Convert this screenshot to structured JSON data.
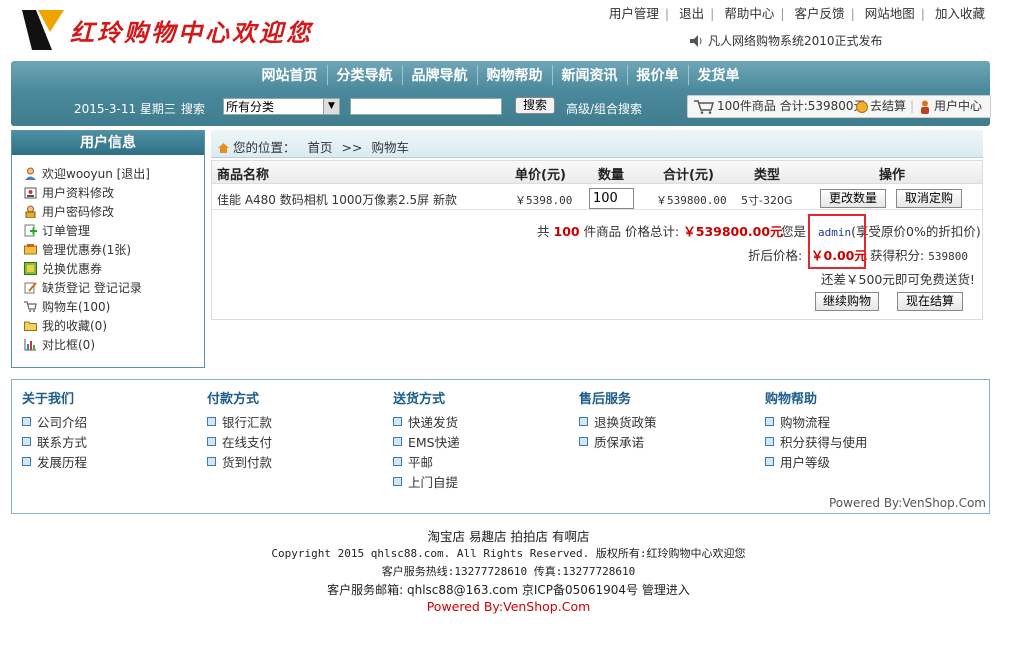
{
  "header": {
    "logo_text": "红玲购物中心欢迎您",
    "top_links": [
      "用户管理",
      "退出",
      "帮助中心",
      "客户反馈",
      "网站地图",
      "加入收藏"
    ],
    "notice": "凡人网络购物系统2010正式发布"
  },
  "nav": {
    "items": [
      "网站首页",
      "分类导航",
      "品牌导航",
      "购物帮助",
      "新闻资讯",
      "报价单",
      "发货单"
    ],
    "date": "2015-3-11 星期三",
    "search_label": "搜索",
    "category_select": "所有分类",
    "search_placeholder": "",
    "search_button": "搜索",
    "advanced_search": "高级/组合搜索",
    "cart_summary": "100件商品 合计:539800元",
    "checkout_link": "去结算",
    "user_center": "用户中心"
  },
  "sidebar": {
    "title": "用户信息",
    "items": [
      {
        "label": "欢迎wooyun [退出]",
        "icon": "user-icon"
      },
      {
        "label": "用户资料修改",
        "icon": "profile-icon"
      },
      {
        "label": "用户密码修改",
        "icon": "lock-icon"
      },
      {
        "label": "订单管理",
        "icon": "order-icon"
      },
      {
        "label": "管理优惠券(1张)",
        "icon": "coupon-icon"
      },
      {
        "label": "兑换优惠券",
        "icon": "exchange-icon"
      },
      {
        "label": "缺货登记 登记记录",
        "icon": "edit-icon"
      },
      {
        "label": "购物车(100)",
        "icon": "cart-icon"
      },
      {
        "label": "我的收藏(0)",
        "icon": "folder-icon"
      },
      {
        "label": "对比框(0)",
        "icon": "chart-icon"
      }
    ]
  },
  "breadcrumb": {
    "prefix": "您的位置：",
    "home": "首页",
    "separator": ">>",
    "current": "购物车"
  },
  "cart": {
    "columns": [
      "商品名称",
      "单价(元)",
      "数量",
      "合计(元)",
      "类型",
      "操作"
    ],
    "row": {
      "name": "佳能 A480 数码相机 1000万像素2.5屏 新款",
      "price": "￥5398.00",
      "quantity": "100",
      "subtotal": "￥539800.00",
      "type": "5寸-320G",
      "update_button": "更改数量",
      "cancel_button": "取消定购"
    },
    "summary_prefix": "共",
    "summary_count": "100",
    "summary_mid": "件商品 价格总计:",
    "summary_total": "￥539800.00元",
    "you_are": "您是",
    "member_name": "admin",
    "member_discount": "(享受原价0%的折扣价)",
    "discount_label": "折后价格:",
    "discount_price": "￥0.00元",
    "points_label": "获得积分:",
    "points_value": "539800",
    "shipping_note": "还差￥500元即可免费送货!",
    "continue_button": "继续购物",
    "checkout_button": "现在结算"
  },
  "footer_links": {
    "columns": [
      {
        "title": "关于我们",
        "items": [
          "公司介绍",
          "联系方式",
          "发展历程"
        ]
      },
      {
        "title": "付款方式",
        "items": [
          "银行汇款",
          "在线支付",
          "货到付款"
        ]
      },
      {
        "title": "送货方式",
        "items": [
          "快递发货",
          "EMS快递",
          "平邮",
          "上门自提"
        ]
      },
      {
        "title": "售后服务",
        "items": [
          "退换货政策",
          "质保承诺"
        ]
      },
      {
        "title": "购物帮助",
        "items": [
          "购物流程",
          "积分获得与使用",
          "用户等级"
        ]
      }
    ],
    "powered": "Powered By:VenShop.Com"
  },
  "bottom": {
    "shops": "淘宝店 易趣店 拍拍店 有啊店",
    "copyright": "Copyright 2015 qhlsc88.com. All Rights Reserved. 版权所有:红玲购物中心欢迎您",
    "hotline": "客户服务热线:13277728610 传真:13277728610",
    "email": "客户服务邮箱: qhlsc88@163.com 京ICP备05061904号 管理进入",
    "powered": "Powered By:VenShop.Com",
    "powered_color": "#d00000"
  }
}
